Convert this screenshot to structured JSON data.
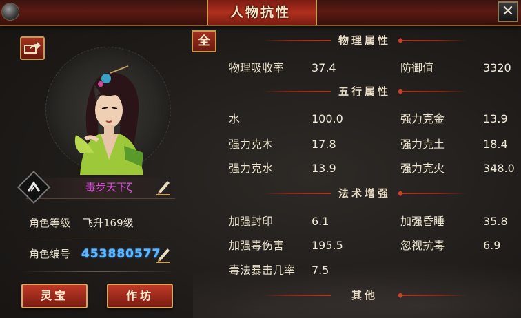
{
  "window": {
    "title": "人物抗性",
    "close_glyph": "✕"
  },
  "character": {
    "name": "毒步天下ζ",
    "level_label": "角色等级",
    "level_value": "飞升169级",
    "id_label": "角色编号",
    "id_value": "453880577"
  },
  "buttons": {
    "all": "全",
    "lingbao": "灵宝",
    "zuofang": "作坊"
  },
  "sections": {
    "physical": {
      "title": "物理属性",
      "rows": [
        {
          "left_label": "物理吸收率",
          "left_value": "37.4",
          "right_label": "防御值",
          "right_value": "3320"
        }
      ]
    },
    "elements": {
      "title": "五行属性",
      "rows": [
        {
          "left_label": "水",
          "left_value": "100.0",
          "right_label": "强力克金",
          "right_value": "13.9"
        },
        {
          "left_label": "强力克木",
          "left_value": "17.8",
          "right_label": "强力克土",
          "right_value": "18.4"
        },
        {
          "left_label": "强力克水",
          "left_value": "13.9",
          "right_label": "强力克火",
          "right_value": "348.0"
        }
      ]
    },
    "magic": {
      "title": "法术增强",
      "rows": [
        {
          "left_label": "加强封印",
          "left_value": "6.1",
          "right_label": "加强昏睡",
          "right_value": "35.8"
        },
        {
          "left_label": "加强毒伤害",
          "left_value": "195.5",
          "right_label": "忽视抗毒",
          "right_value": "6.9"
        },
        {
          "left_label": "毒法暴击几率",
          "left_value": "7.5"
        }
      ]
    },
    "other": {
      "title": "其他"
    }
  },
  "colors": {
    "accent_red": "#b0301e",
    "gold_border": "#c89a52",
    "name_purple": "#d54bd8",
    "id_blue": "#5ab8ff"
  },
  "icons": {
    "share": "share-icon",
    "edit": "pen-icon",
    "emblem": "sect-emblem-icon",
    "close": "close-icon"
  }
}
